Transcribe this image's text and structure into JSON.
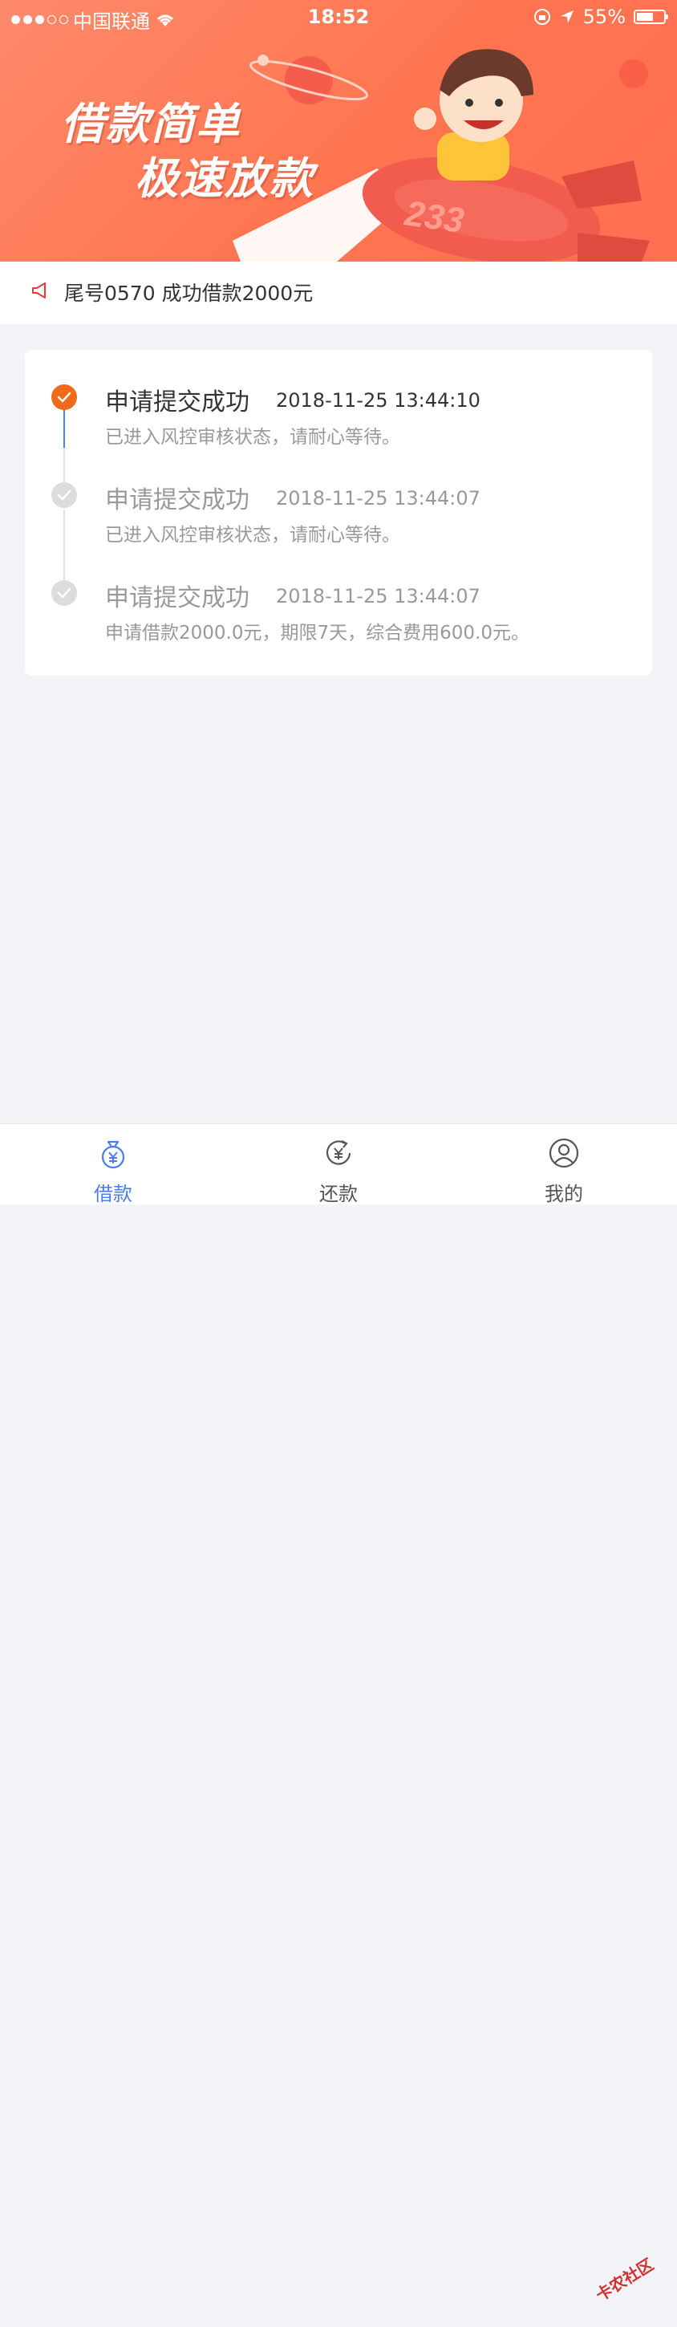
{
  "status_bar": {
    "carrier": "中国联通",
    "time": "18:52",
    "battery": "55%"
  },
  "banner": {
    "line1": "借款简单",
    "line2": "极速放款",
    "rocket_number": "233"
  },
  "notice": {
    "text": "尾号0570 成功借款2000元"
  },
  "timeline": [
    {
      "title": "申请提交成功",
      "time": "2018-11-25 13:44:10",
      "desc": "已进入风控审核状态，请耐心等待。",
      "state": "active"
    },
    {
      "title": "申请提交成功",
      "time": "2018-11-25 13:44:07",
      "desc": "已进入风控审核状态，请耐心等待。",
      "state": "done"
    },
    {
      "title": "申请提交成功",
      "time": "2018-11-25 13:44:07",
      "desc": "申请借款2000.0元，期限7天，综合费用600.0元。",
      "state": "done"
    }
  ],
  "tabbar": {
    "tabs": [
      {
        "label": "借款",
        "icon": "money-bag-icon"
      },
      {
        "label": "还款",
        "icon": "repay-icon"
      },
      {
        "label": "我的",
        "icon": "user-icon"
      }
    ]
  },
  "watermark": "卡农社区",
  "colors": {
    "accent": "#4a7df2",
    "banner": "#ff7a57",
    "active_dot": "#f06a1a",
    "inactive_dot": "#dcdcdc"
  }
}
